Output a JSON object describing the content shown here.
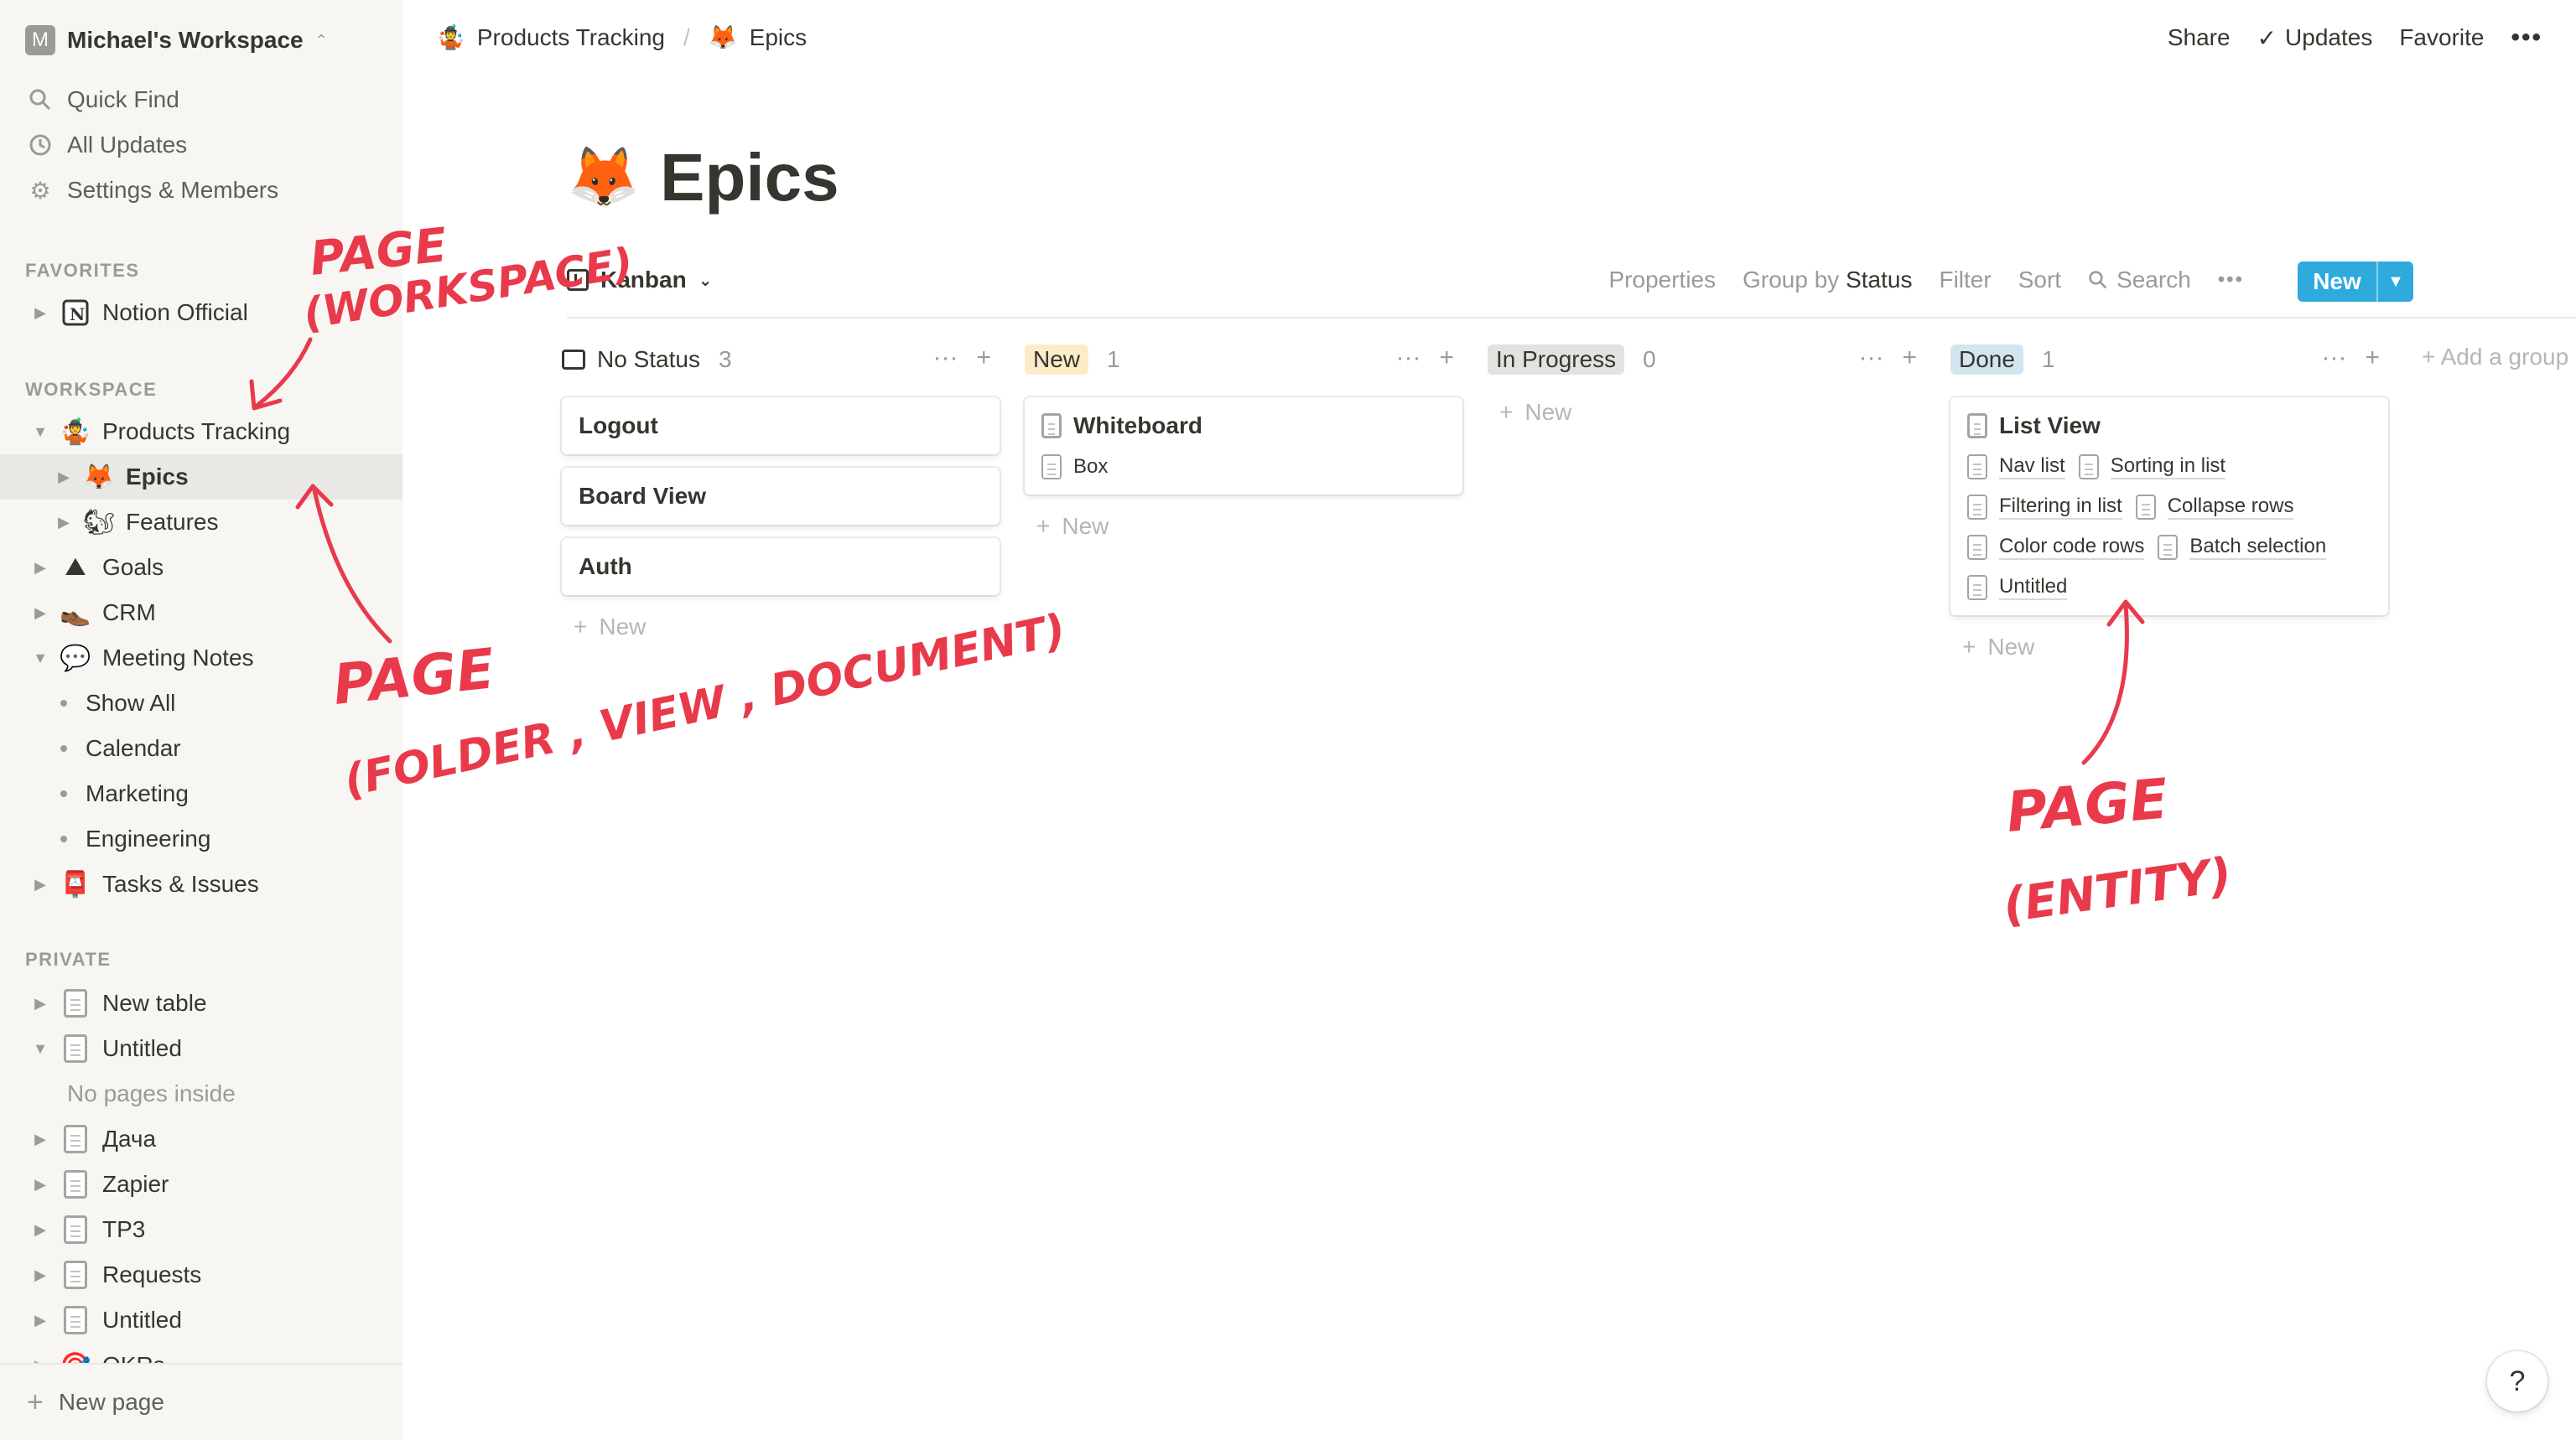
{
  "sidebar": {
    "workspace_initial": "M",
    "workspace_name": "Michael's Workspace",
    "quick_find": "Quick Find",
    "all_updates": "All Updates",
    "settings": "Settings & Members",
    "favorites_label": "FAVORITES",
    "workspace_label": "WORKSPACE",
    "private_label": "PRIVATE",
    "favorites": [
      {
        "label": "Notion Official",
        "icon": "notion-logo-icon"
      }
    ],
    "workspace": [
      {
        "label": "Products Tracking",
        "icon": "juggler-emoji-icon",
        "glyph": "🤹"
      },
      {
        "label": "Epics",
        "icon": "fox-emoji-icon",
        "glyph": "🦊"
      },
      {
        "label": "Features",
        "icon": "squirrel-emoji-icon",
        "glyph": "🐿"
      },
      {
        "label": "Goals",
        "icon": "mountain-emoji-icon",
        "glyph": "⛰"
      },
      {
        "label": "CRM",
        "icon": "shoe-emoji-icon",
        "glyph": "👞"
      },
      {
        "label": "Meeting Notes",
        "icon": "speech-bubble-emoji-icon",
        "glyph": "💬"
      },
      {
        "label": "Show All"
      },
      {
        "label": "Calendar"
      },
      {
        "label": "Marketing"
      },
      {
        "label": "Engineering"
      },
      {
        "label": "Tasks & Issues",
        "icon": "postbox-emoji-icon",
        "glyph": "📮"
      }
    ],
    "private": [
      {
        "label": "New table"
      },
      {
        "label": "Untitled"
      },
      {
        "label": "No pages inside"
      },
      {
        "label": "Дача"
      },
      {
        "label": "Zapier"
      },
      {
        "label": "TP3"
      },
      {
        "label": "Requests"
      },
      {
        "label": "Untitled"
      },
      {
        "label": "OKRs"
      }
    ],
    "new_page": "New page"
  },
  "topbar": {
    "crumbs": [
      {
        "label": "Products Tracking",
        "glyph": "🤹"
      },
      {
        "label": "Epics",
        "glyph": "🦊"
      }
    ],
    "share": "Share",
    "updates": "Updates",
    "favorite": "Favorite"
  },
  "page": {
    "emoji": "🦊",
    "title": "Epics",
    "view_name": "Kanban",
    "tools": {
      "properties": "Properties",
      "group_by": "Group by",
      "group_by_value": "Status",
      "filter": "Filter",
      "sort": "Sort",
      "search": "Search",
      "new": "New"
    }
  },
  "board": {
    "columns": [
      {
        "name": "No Status",
        "count": "3",
        "color": "",
        "cards": [
          {
            "title": "Logout"
          },
          {
            "title": "Board View"
          },
          {
            "title": "Auth"
          }
        ],
        "new_label": "New"
      },
      {
        "name": "New",
        "count": "1",
        "color": "#fdecc8",
        "cards": [
          {
            "title": "Whiteboard",
            "subs": [
              "Box"
            ]
          }
        ],
        "new_label": "New"
      },
      {
        "name": "In Progress",
        "count": "0",
        "color": "#e3e2e0",
        "cards": [],
        "new_label": "New"
      },
      {
        "name": "Done",
        "count": "1",
        "color": "#d3e5ef",
        "cards": [
          {
            "title": "List View",
            "subs": [
              "Nav list",
              "Sorting in list",
              "Filtering in list",
              "Collapse rows",
              "Color code rows",
              "Batch selection",
              "Untitled"
            ]
          }
        ],
        "new_label": "New"
      }
    ],
    "add_group": "Add a group"
  },
  "annotations": {
    "workspace_1": "PAGE",
    "workspace_2": "(WORKSPACE)",
    "folder_1": "PAGE",
    "folder_2": "(FOLDER , VIEW , DOCUMENT)",
    "entity_1": "PAGE",
    "entity_2": "(ENTITY)",
    "color": "#e83a4a"
  },
  "help": "?"
}
